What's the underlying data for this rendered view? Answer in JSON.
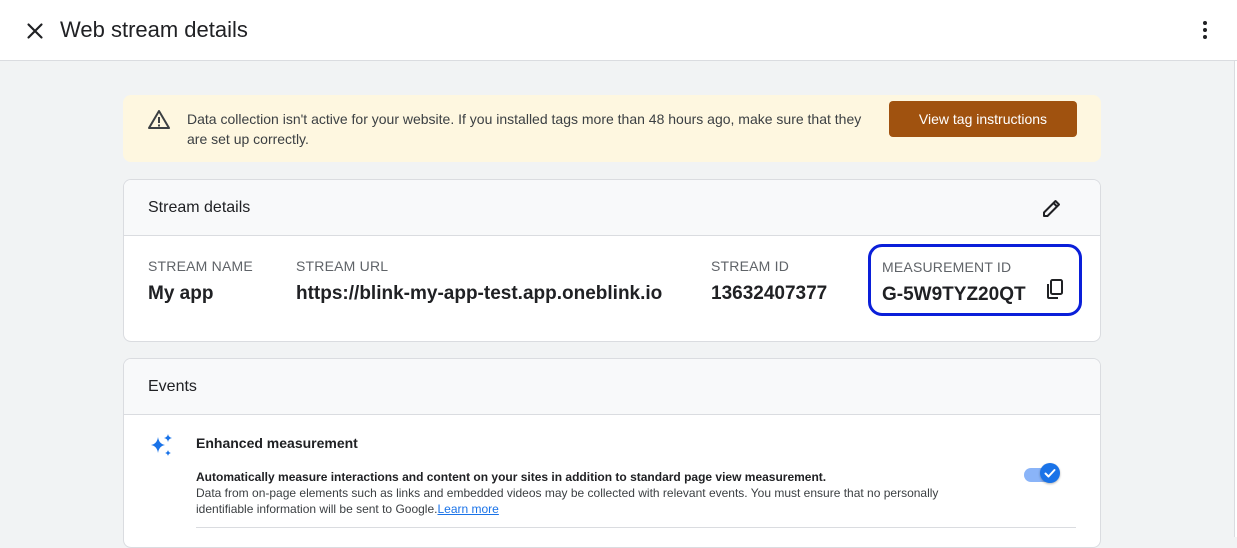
{
  "header": {
    "title": "Web stream details",
    "close_icon": "close-icon",
    "more_icon": "more-vert-icon"
  },
  "banner": {
    "message": "Data collection isn't active for your website. If you installed tags more than 48 hours ago, make sure that they are set up correctly.",
    "button_label": "View tag instructions",
    "icon": "warning-icon",
    "button_color": "#a0520f",
    "background": "#fef7e0"
  },
  "stream_details": {
    "title": "Stream details",
    "edit_icon": "edit-icon",
    "fields": {
      "stream_name": {
        "label": "STREAM NAME",
        "value": "My app"
      },
      "stream_url": {
        "label": "STREAM URL",
        "value": "https://blink-my-app-test.app.oneblink.io"
      },
      "stream_id": {
        "label": "STREAM ID",
        "value": "13632407377"
      },
      "measurement_id": {
        "label": "MEASUREMENT ID",
        "value": "G-5W9TYZ20QT",
        "copy_icon": "copy-icon"
      }
    },
    "highlight_color": "#0a1fd9"
  },
  "events": {
    "title": "Events",
    "enhanced": {
      "icon": "sparkle-icon",
      "title": "Enhanced measurement",
      "desc_bold": "Automatically measure interactions and content on your sites in addition to standard page view measurement.",
      "desc": "Data from on-page elements such as links and embedded videos may be collected with relevant events. You must ensure that no personally identifiable information will be sent to Google.",
      "link": "Learn more",
      "enabled": true
    }
  },
  "colors": {
    "accent": "#1a73e8",
    "page_bg": "#f1f3f4"
  }
}
